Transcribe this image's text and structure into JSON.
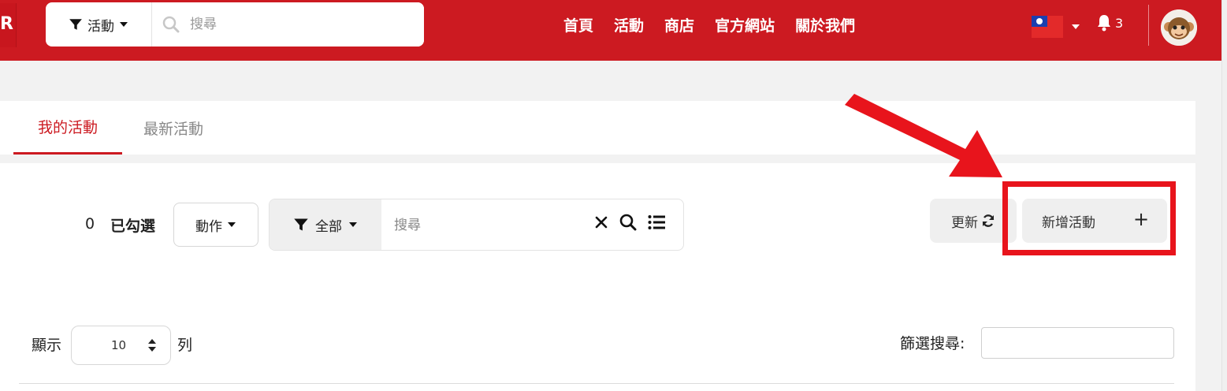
{
  "header": {
    "logo_letter": "R",
    "search_filter_label": "活動",
    "search_placeholder": "搜尋",
    "nav": [
      "首頁",
      "活動",
      "商店",
      "官方網站",
      "關於我們"
    ],
    "notification_count": "3",
    "brand_color": "#cc1a21"
  },
  "tabs": [
    {
      "label": "我的活動",
      "active": true
    },
    {
      "label": "最新活動",
      "active": false
    }
  ],
  "toolbar": {
    "selected_count": "0",
    "selected_label": "已勾選",
    "action_label": "動作",
    "filter_label": "全部",
    "search_placeholder": "搜尋",
    "refresh_label": "更新",
    "add_label": "新增活動"
  },
  "table_controls": {
    "show_label": "顯示",
    "page_length": "10",
    "rows_label": "列",
    "filter_search_label": "篩選搜尋:",
    "filter_value": ""
  },
  "annotation": {
    "highlight_color": "#e8141c",
    "target": "add-activity-button"
  }
}
